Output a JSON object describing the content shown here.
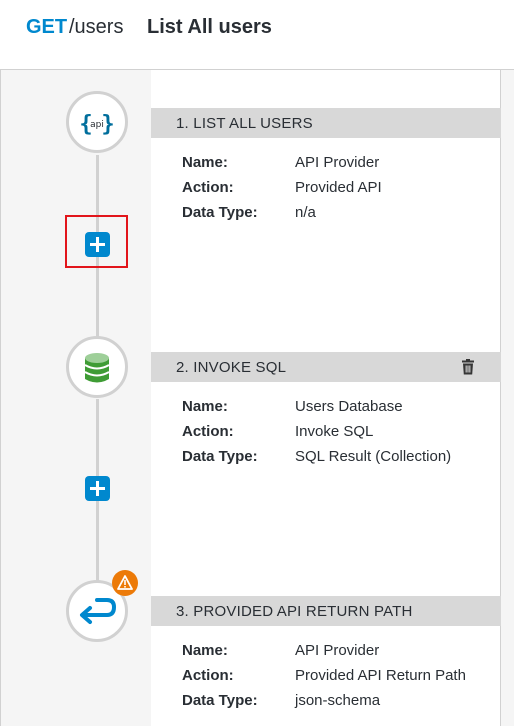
{
  "header": {
    "method": "GET",
    "path": "/users",
    "title": "List All users"
  },
  "steps": [
    {
      "title": "1. LIST ALL USERS",
      "icon": "api-icon",
      "details": [
        {
          "label": "Name:",
          "value": "API Provider"
        },
        {
          "label": "Action:",
          "value": "Provided API"
        },
        {
          "label": "Data Type:",
          "value": "n/a"
        }
      ]
    },
    {
      "title": "2. INVOKE SQL",
      "icon": "database-icon",
      "details": [
        {
          "label": "Name:",
          "value": "Users Database"
        },
        {
          "label": "Action:",
          "value": "Invoke SQL"
        },
        {
          "label": "Data Type:",
          "value": "SQL Result (Collection)"
        }
      ]
    },
    {
      "title": "3. PROVIDED API RETURN PATH",
      "icon": "return-arrow-icon",
      "warning_icon": "warning-triangle-icon",
      "details": [
        {
          "label": "Name:",
          "value": "API Provider"
        },
        {
          "label": "Action:",
          "value": "Provided API Return Path"
        },
        {
          "label": "Data Type:",
          "value": "json-schema"
        }
      ]
    }
  ],
  "add_buttons": [
    "plus-icon",
    "plus-icon"
  ],
  "colors": {
    "accent": "#0088ce",
    "highlight": "#e2151b",
    "warning": "#ec7a08",
    "database": "#3f9c35",
    "step_header": "#d8d8d8"
  }
}
